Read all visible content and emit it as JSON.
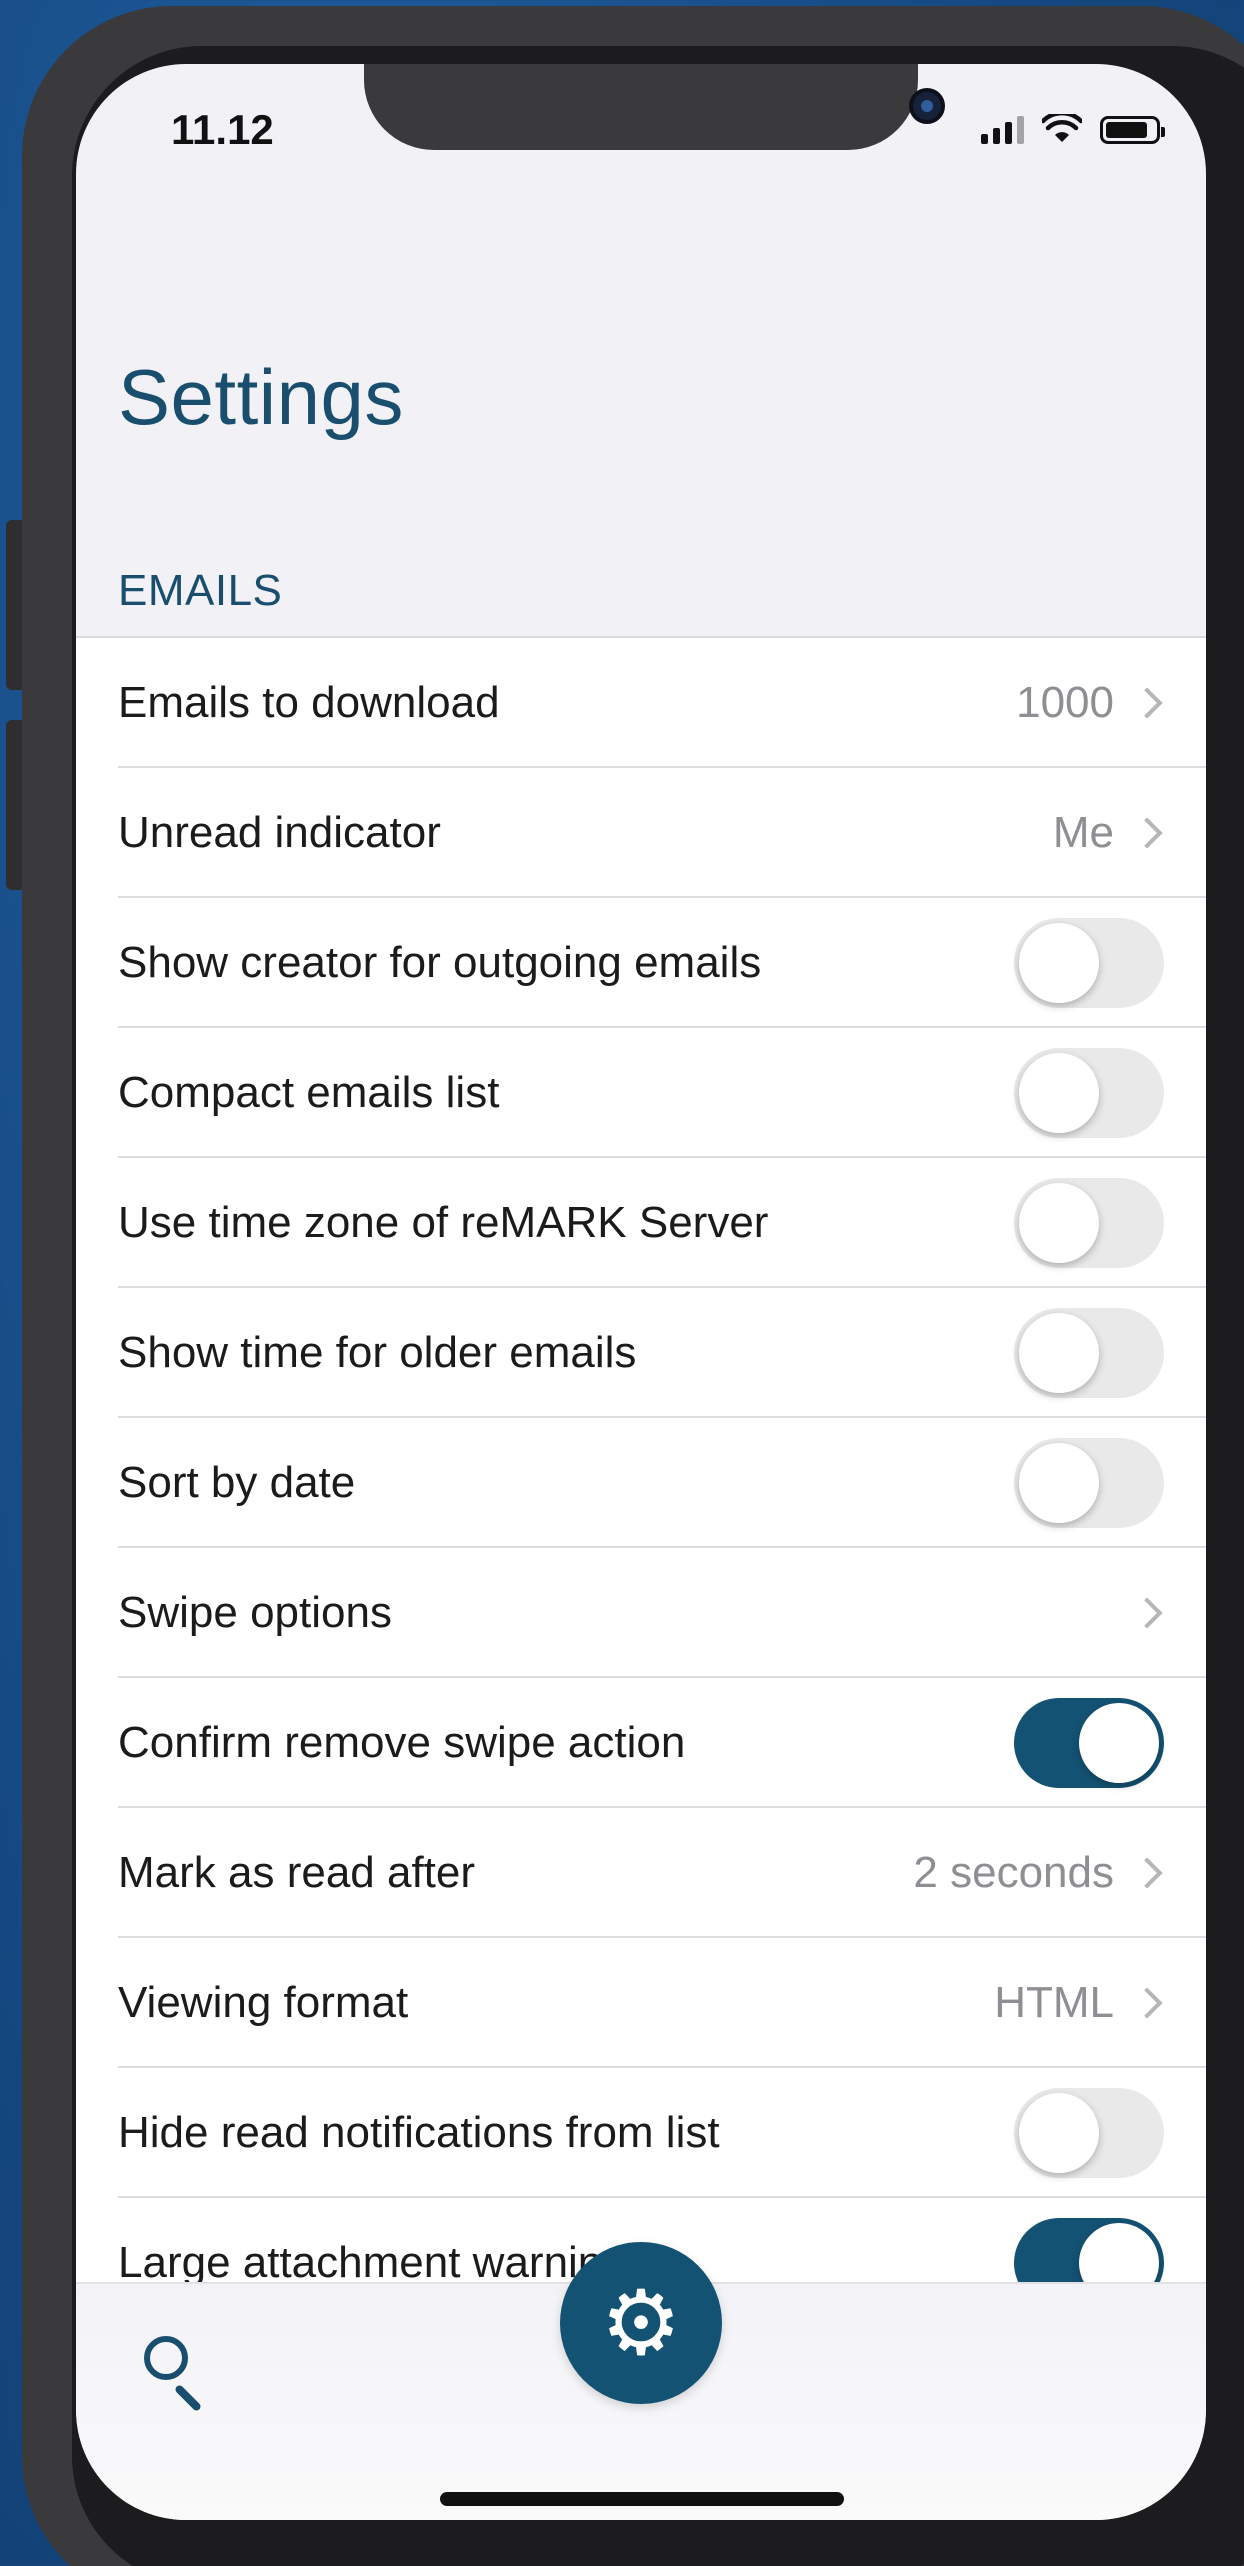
{
  "status_bar": {
    "time": "11.12",
    "icons": [
      "signal-icon",
      "wifi-icon",
      "battery-icon"
    ]
  },
  "page": {
    "title": "Settings",
    "section_header": "EMAILS"
  },
  "rows": [
    {
      "label": "Emails to download",
      "type": "value",
      "value": "1000"
    },
    {
      "label": "Unread indicator",
      "type": "value",
      "value": "Me"
    },
    {
      "label": "Show creator for outgoing emails",
      "type": "toggle",
      "on": false
    },
    {
      "label": "Compact emails list",
      "type": "toggle",
      "on": false
    },
    {
      "label": "Use time zone of reMARK Server",
      "type": "toggle",
      "on": false
    },
    {
      "label": "Show time for older emails",
      "type": "toggle",
      "on": false
    },
    {
      "label": "Sort by date",
      "type": "toggle",
      "on": false
    },
    {
      "label": "Swipe options",
      "type": "nav"
    },
    {
      "label": "Confirm remove swipe action",
      "type": "toggle",
      "on": true
    },
    {
      "label": "Mark as read after",
      "type": "value",
      "value": "2 seconds"
    },
    {
      "label": "Viewing format",
      "type": "value",
      "value": "HTML"
    },
    {
      "label": "Hide read notifications from list",
      "type": "toggle",
      "on": false
    },
    {
      "label": "Large attachment warning",
      "type": "toggle",
      "on": true
    }
  ],
  "bottom_bar": {
    "left_icon": "search-icon",
    "center_icon": "gear-icon"
  },
  "colors": {
    "accent": "#145273",
    "title": "#1a4e6e",
    "toggle_off": "#e9e9ea"
  }
}
